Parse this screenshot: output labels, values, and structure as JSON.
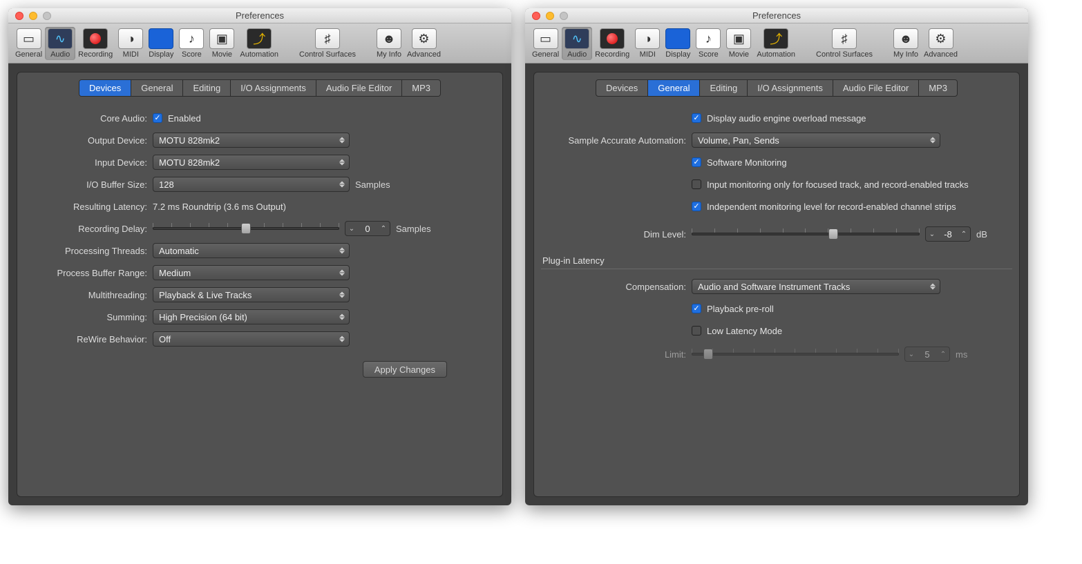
{
  "windowTitle": "Preferences",
  "toolbar": [
    {
      "id": "general",
      "label": "General"
    },
    {
      "id": "audio",
      "label": "Audio"
    },
    {
      "id": "recording",
      "label": "Recording"
    },
    {
      "id": "midi",
      "label": "MIDI"
    },
    {
      "id": "display",
      "label": "Display"
    },
    {
      "id": "score",
      "label": "Score"
    },
    {
      "id": "movie",
      "label": "Movie"
    },
    {
      "id": "automation",
      "label": "Automation"
    },
    {
      "id": "controlsurfaces",
      "label": "Control Surfaces"
    },
    {
      "id": "myinfo",
      "label": "My Info"
    },
    {
      "id": "advanced",
      "label": "Advanced"
    }
  ],
  "tabs": [
    "Devices",
    "General",
    "Editing",
    "I/O Assignments",
    "Audio File Editor",
    "MP3"
  ],
  "left": {
    "activeTab": "Devices",
    "coreAudio": {
      "label": "Core Audio:",
      "checkLabel": "Enabled",
      "checked": true
    },
    "outputDevice": {
      "label": "Output Device:",
      "value": "MOTU 828mk2"
    },
    "inputDevice": {
      "label": "Input Device:",
      "value": "MOTU 828mk2"
    },
    "ioBuffer": {
      "label": "I/O Buffer Size:",
      "value": "128",
      "unit": "Samples"
    },
    "latency": {
      "label": "Resulting Latency:",
      "value": "7.2 ms Roundtrip (3.6 ms Output)"
    },
    "recDelay": {
      "label": "Recording Delay:",
      "value": "0",
      "unit": "Samples",
      "pos": 50
    },
    "threads": {
      "label": "Processing Threads:",
      "value": "Automatic"
    },
    "procBuffer": {
      "label": "Process Buffer Range:",
      "value": "Medium"
    },
    "multithreading": {
      "label": "Multithreading:",
      "value": "Playback & Live Tracks"
    },
    "summing": {
      "label": "Summing:",
      "value": "High Precision (64 bit)"
    },
    "rewire": {
      "label": "ReWire Behavior:",
      "value": "Off"
    },
    "apply": "Apply Changes"
  },
  "right": {
    "activeTab": "General",
    "overload": {
      "label": "Display audio engine overload message",
      "checked": true
    },
    "sampleAccurate": {
      "label": "Sample Accurate Automation:",
      "value": "Volume, Pan, Sends"
    },
    "swmon": {
      "label": "Software Monitoring",
      "checked": true
    },
    "inputMon": {
      "label": "Input monitoring only for focused track, and record-enabled tracks",
      "checked": false
    },
    "indep": {
      "label": "Independent monitoring level for record-enabled channel strips",
      "checked": true
    },
    "dim": {
      "label": "Dim Level:",
      "value": "-8",
      "unit": "dB",
      "pos": 62
    },
    "plugLatency": {
      "title": "Plug-in Latency"
    },
    "comp": {
      "label": "Compensation:",
      "value": "Audio and Software Instrument Tracks"
    },
    "preroll": {
      "label": "Playback pre-roll",
      "checked": true
    },
    "lowlat": {
      "label": "Low Latency Mode",
      "checked": false
    },
    "limit": {
      "label": "Limit:",
      "value": "5",
      "unit": "ms",
      "pos": 8,
      "disabled": true
    }
  }
}
